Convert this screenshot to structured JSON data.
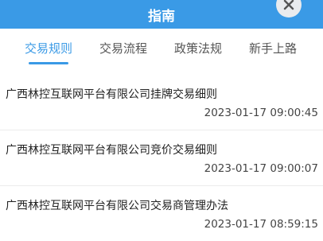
{
  "header": {
    "title": "指南",
    "close_icon": "close-icon"
  },
  "tabs": [
    {
      "label": "交易规则",
      "active": true
    },
    {
      "label": "交易流程",
      "active": false
    },
    {
      "label": "政策法规",
      "active": false
    },
    {
      "label": "新手上路",
      "active": false
    }
  ],
  "articles": [
    {
      "title": "广西林控互联网平台有限公司挂牌交易细则",
      "time": "2023-01-17 09:00:45"
    },
    {
      "title": "广西林控互联网平台有限公司竞价交易细则",
      "time": "2023-01-17 09:00:07"
    },
    {
      "title": "广西林控互联网平台有限公司交易商管理办法",
      "time": "2023-01-17 08:59:15"
    }
  ],
  "colors": {
    "accent": "#3a9ae6",
    "close_bg": "#e9ebee"
  }
}
